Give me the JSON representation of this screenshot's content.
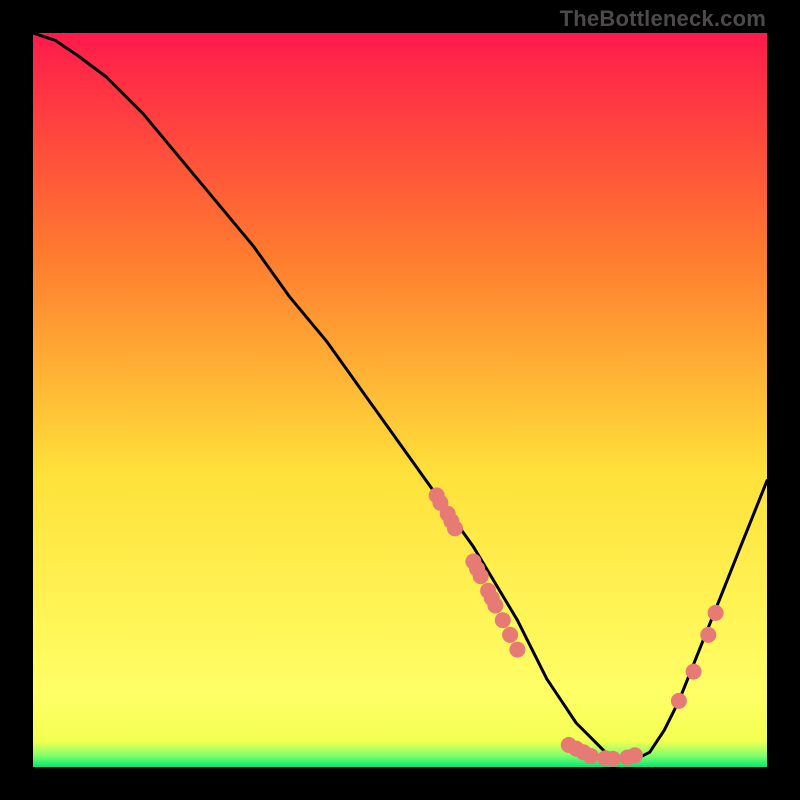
{
  "watermark": "TheBottleneck.com",
  "colors": {
    "gradient_top": "#ff1a4b",
    "gradient_mid1": "#ff7a2f",
    "gradient_mid2": "#ffe13a",
    "gradient_mid3": "#ffff66",
    "gradient_bottom": "#00e874",
    "curve": "#000000",
    "marker": "#e77a74"
  },
  "chart_data": {
    "type": "line",
    "title": "",
    "xlabel": "",
    "ylabel": "",
    "xlim": [
      0,
      100
    ],
    "ylim": [
      0,
      100
    ],
    "series": [
      {
        "name": "bottleneck-curve",
        "x": [
          0,
          3,
          6,
          10,
          15,
          20,
          25,
          30,
          35,
          40,
          45,
          50,
          55,
          60,
          63,
          66,
          68,
          70,
          72,
          74,
          76,
          78,
          80,
          82,
          84,
          86,
          88,
          90,
          92,
          94,
          96,
          98,
          100
        ],
        "y": [
          100,
          99,
          97,
          94,
          89,
          83,
          77,
          71,
          64,
          58,
          51,
          44,
          37,
          30,
          25,
          20,
          16,
          12,
          9,
          6,
          4,
          2,
          1,
          1,
          2,
          5,
          9,
          14,
          19,
          24,
          29,
          34,
          39
        ]
      }
    ],
    "markers": {
      "name": "highlighted-points",
      "points": [
        {
          "x": 55,
          "y": 37
        },
        {
          "x": 55.5,
          "y": 36
        },
        {
          "x": 56.5,
          "y": 34.5
        },
        {
          "x": 57,
          "y": 33.5
        },
        {
          "x": 57.5,
          "y": 32.5
        },
        {
          "x": 60,
          "y": 28
        },
        {
          "x": 60.5,
          "y": 27
        },
        {
          "x": 61,
          "y": 26
        },
        {
          "x": 62,
          "y": 24
        },
        {
          "x": 62.5,
          "y": 23
        },
        {
          "x": 63,
          "y": 22
        },
        {
          "x": 64,
          "y": 20
        },
        {
          "x": 65,
          "y": 18
        },
        {
          "x": 66,
          "y": 16
        },
        {
          "x": 73,
          "y": 3
        },
        {
          "x": 74,
          "y": 2.5
        },
        {
          "x": 75,
          "y": 2
        },
        {
          "x": 76,
          "y": 1.5
        },
        {
          "x": 78,
          "y": 1.2
        },
        {
          "x": 79,
          "y": 1.1
        },
        {
          "x": 81,
          "y": 1.3
        },
        {
          "x": 82,
          "y": 1.6
        },
        {
          "x": 88,
          "y": 9
        },
        {
          "x": 90,
          "y": 13
        },
        {
          "x": 92,
          "y": 18
        },
        {
          "x": 93,
          "y": 21
        }
      ]
    }
  }
}
